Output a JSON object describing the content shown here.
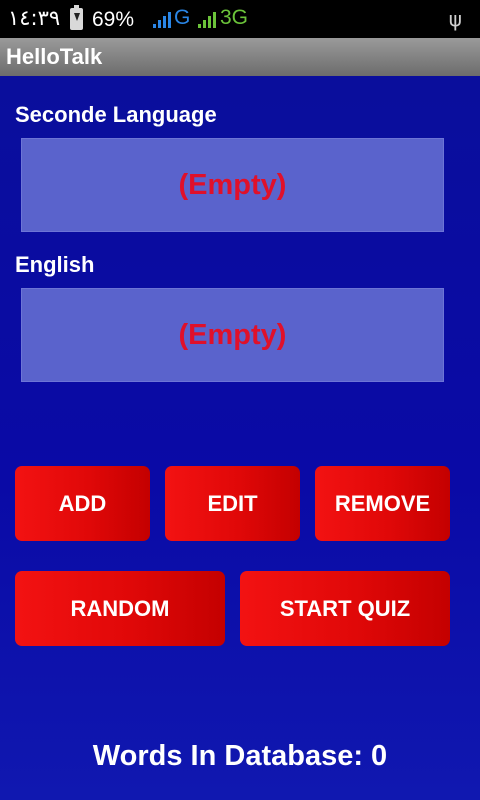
{
  "status_bar": {
    "time": "١٤:٣٩",
    "battery_percent": "69%",
    "network_1": "G",
    "network_2": "3G",
    "icons": [
      "battery-charging-icon",
      "signal-icon",
      "signal-icon",
      "usb-icon"
    ]
  },
  "app": {
    "title": "HelloTalk"
  },
  "second_language": {
    "label": "Seconde Language",
    "value": "(Empty)"
  },
  "english": {
    "label": "English",
    "value": "(Empty)"
  },
  "buttons": {
    "add": "ADD",
    "edit": "EDIT",
    "remove": "REMOVE",
    "random": "RANDOM",
    "start_quiz": "START QUIZ"
  },
  "footer": {
    "words_count": "Words In Database: 0"
  },
  "colors": {
    "background": "#0a0fa0",
    "field_bg": "#5a63cc",
    "empty_text": "#e0102a",
    "button": "#e00808"
  }
}
